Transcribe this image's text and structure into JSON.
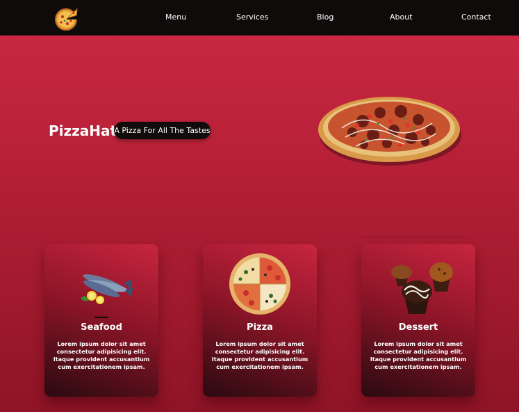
{
  "nav": {
    "logo_icon": "pizza-slice-logo-icon",
    "links": [
      "Menu",
      "Services",
      "Blog",
      "About",
      "Contact"
    ]
  },
  "hero": {
    "brand": "PizzaHat",
    "tagline": "A Pizza For All The Tastes",
    "image_icon": "pizza-image"
  },
  "cards": [
    {
      "title": "Seafood",
      "icon": "fish-image",
      "text": "Lorem ipsum dolor sit amet consectetur adipisicing elit. Itaque provident accusantium cum exercitationem ipsam."
    },
    {
      "title": "Pizza",
      "icon": "pizza-image",
      "text": "Lorem ipsum dolor sit amet consectetur adipisicing elit. Itaque provident accusantium cum exercitationem ipsam."
    },
    {
      "title": "Dessert",
      "icon": "cupcakes-image",
      "text": "Lorem ipsum dolor sit amet consectetur adipisicing elit. Itaque provident accusantium cum exercitationem ipsam."
    }
  ],
  "colors": {
    "navbar": "#100b0b",
    "background_top": "#cd2a44",
    "background_bottom": "#8e1426",
    "tagline_bg": "#110c0c"
  }
}
